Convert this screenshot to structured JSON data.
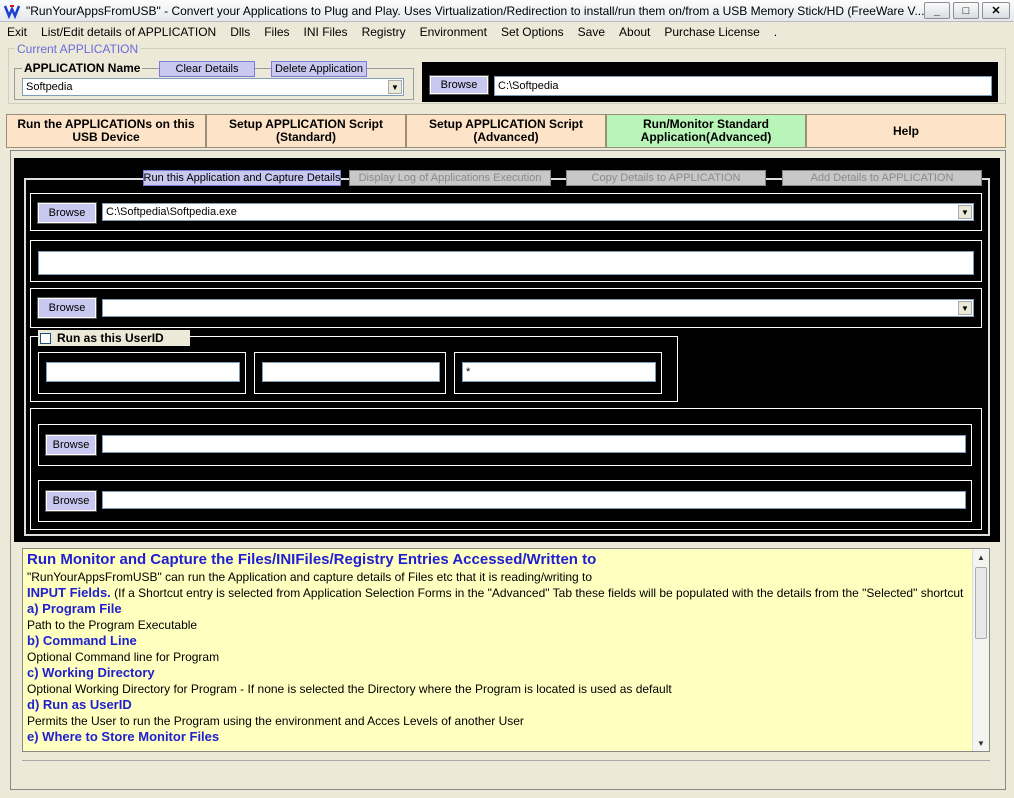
{
  "window": {
    "title": "\"RunYourAppsFromUSB\" - Convert your Applications to Plug and Play. Uses Virtualization/Redirection to install/run them on/from a USB Memory Stick/HD (FreeWare V...",
    "minimize": "_",
    "maximize": "□",
    "close": "✕"
  },
  "menu": [
    "Exit",
    "List/Edit details of APPLICATION",
    "Dlls",
    "Files",
    "INI Files",
    "Registry",
    "Environment",
    "Set Options",
    "Save",
    "About",
    "Purchase License",
    "."
  ],
  "current": {
    "legend": "Current APPLICATION",
    "name_label": "APPLICATION Name",
    "clear_label": "Clear Details",
    "delete_label": "Delete Application",
    "app_name": "Softpedia",
    "browse_label": "Browse",
    "path": "C:\\Softpedia"
  },
  "tabs": [
    {
      "label": "Run the APPLICATIONs on this USB Device"
    },
    {
      "label": "Setup APPLICATION Script (Standard)"
    },
    {
      "label": "Setup APPLICATION Script (Advanced)"
    },
    {
      "label": "Run/Monitor Standard Application(Advanced)"
    },
    {
      "label": "Help"
    }
  ],
  "actions": {
    "run_capture": "Run this Application and Capture Details",
    "display_log": "Display Log of Applications Execution",
    "copy_details": "Copy Details to APPLICATION",
    "add_details": "Add Details to APPLICATION"
  },
  "program": {
    "browse_label": "Browse",
    "file": "C:\\Softpedia\\Softpedia.exe",
    "command_line": "",
    "working_dir": ""
  },
  "runas": {
    "label": "Run as this UserID",
    "user": "",
    "domain": "",
    "password": "*"
  },
  "store": {
    "browse1": "Browse",
    "browse2": "Browse",
    "path1": "",
    "path2": ""
  },
  "help": {
    "heading": "Run Monitor and Capture the Files/INIFiles/Registry Entries Accessed/Written to",
    "intro": "\"RunYourAppsFromUSB\" can run the Application and capture details of Files etc that it is reading/writing to",
    "input_title": "INPUT Fields.",
    "input_text": " (If a Shortcut entry is selected from Application Selection Forms in the \"Advanced\" Tab these fields will be populated with the details from the \"Selected\" shortcut",
    "a_title": "a) Program File",
    "a_text": "Path to the Program Executable",
    "b_title": "b) Command Line",
    "b_text": "Optional Command line for Program",
    "c_title": "c) Working Directory",
    "c_text": "Optional Working Directory for Program - If none is selected the Directory where the Program is located is used as default",
    "d_title": "d) Run as UserID",
    "d_text": "Permits the User to run the Program using the environment and Acces Levels of another User",
    "e_title": "e) Where to Store Monitor Files"
  }
}
